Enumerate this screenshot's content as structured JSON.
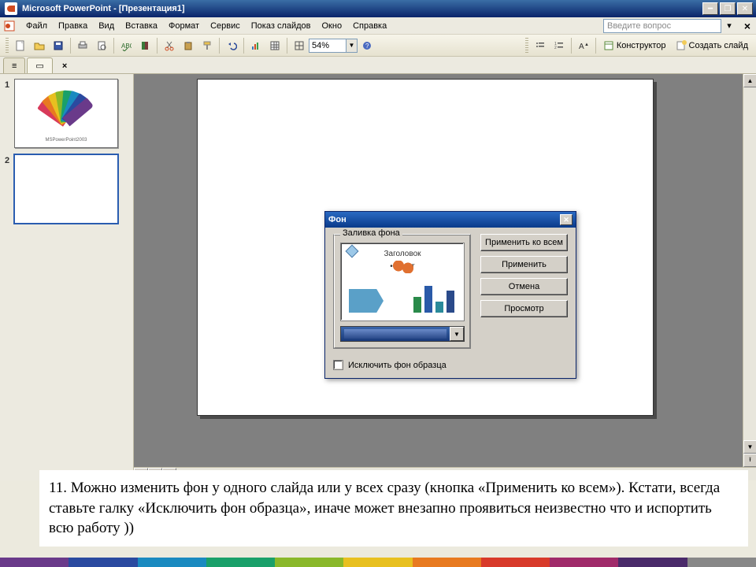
{
  "window": {
    "title": "Microsoft PowerPoint - [Презентация1]"
  },
  "menu": {
    "file": "Файл",
    "edit": "Правка",
    "view": "Вид",
    "insert": "Вставка",
    "format": "Формат",
    "tools": "Сервис",
    "slideshow": "Показ слайдов",
    "window": "Окно",
    "help": "Справка",
    "ask_placeholder": "Введите вопрос"
  },
  "toolbar": {
    "zoom": "54%",
    "designer": "Конструктор",
    "new_slide": "Создать слайд"
  },
  "thumbs": {
    "n1": "1",
    "n2": "2",
    "cap1": "MSPowerPoint2003"
  },
  "dialog": {
    "title": "Фон",
    "group": "Заливка фона",
    "preview_head": "Заголовок",
    "preview_bullet": "• Текст",
    "btn_apply_all": "Применить ко всем",
    "btn_apply": "Применить",
    "btn_cancel": "Отмена",
    "btn_preview": "Просмотр",
    "exclude": "Исключить фон образца"
  },
  "caption": {
    "text": "11.   Можно изменить фон у одного слайда или у всех сразу (кнопка «Применить ко всем»). Кстати, всегда ставьте галку «Исключить фон образца», иначе может внезапно проявиться неизвестно что и испортить всю работу ))"
  },
  "colors": {
    "strip": [
      "#6a3a8a",
      "#2a4aa0",
      "#1a8ac0",
      "#1aa06a",
      "#8ab82a",
      "#e8c020",
      "#e87a20",
      "#d83a2a",
      "#a02a6a",
      "#4a2a6a",
      "#888"
    ]
  }
}
